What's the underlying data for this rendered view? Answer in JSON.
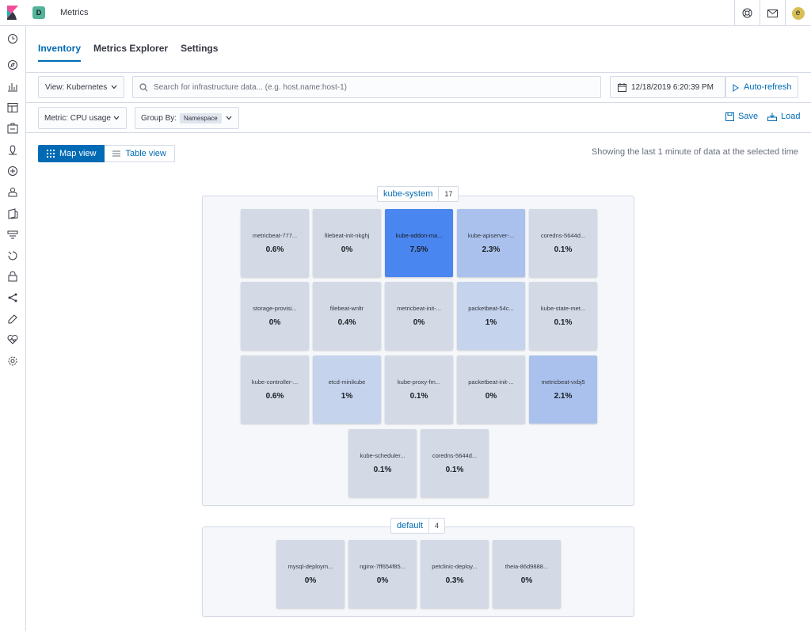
{
  "header": {
    "space_initial": "D",
    "app_title": "Metrics",
    "user_initial": "e"
  },
  "tabs": [
    {
      "label": "Inventory",
      "active": true
    },
    {
      "label": "Metrics Explorer",
      "active": false
    },
    {
      "label": "Settings",
      "active": false
    }
  ],
  "toolbar": {
    "view_select": "View: Kubernetes",
    "search_placeholder": "Search for infrastructure data... (e.g. host.name:host-1)",
    "date": "12/18/2019 6:20:39 PM",
    "auto_refresh": "Auto-refresh",
    "metric_select": "Metric: CPU usage",
    "group_by_label": "Group By:",
    "group_by_value": "Namespace",
    "save": "Save",
    "load": "Load"
  },
  "view_toggle": {
    "map": "Map view",
    "table": "Table view",
    "selected": "map"
  },
  "showing_text": "Showing the last 1 minute of data at the selected time",
  "colors": {
    "accent": "#006bb4",
    "node_low": "#d3dae6",
    "node_mid": "#c5d3ec",
    "node_high": "#a9c1ec",
    "node_max": "#4a86f0"
  },
  "groups": [
    {
      "name": "kube-system",
      "count": "17",
      "nodes": [
        {
          "name": "metricbeat-777...",
          "value": "0.6%",
          "level": "low"
        },
        {
          "name": "filebeat-init-nkghj",
          "value": "0%",
          "level": "low"
        },
        {
          "name": "kube-addon-ma...",
          "value": "7.5%",
          "level": "max"
        },
        {
          "name": "kube-apiserver-...",
          "value": "2.3%",
          "level": "high"
        },
        {
          "name": "coredns-5644d...",
          "value": "0.1%",
          "level": "low"
        },
        {
          "name": "storage-provisi...",
          "value": "0%",
          "level": "low"
        },
        {
          "name": "filebeat-wnltr",
          "value": "0.4%",
          "level": "low"
        },
        {
          "name": "metricbeat-init-...",
          "value": "0%",
          "level": "low"
        },
        {
          "name": "packetbeat-54c...",
          "value": "1%",
          "level": "mid"
        },
        {
          "name": "kube-state-met...",
          "value": "0.1%",
          "level": "low"
        },
        {
          "name": "kube-controller-...",
          "value": "0.6%",
          "level": "low"
        },
        {
          "name": "etcd-minikube",
          "value": "1%",
          "level": "mid"
        },
        {
          "name": "kube-proxy-fm...",
          "value": "0.1%",
          "level": "low"
        },
        {
          "name": "packetbeat-init-...",
          "value": "0%",
          "level": "low"
        },
        {
          "name": "metricbeat-vxbj5",
          "value": "2.1%",
          "level": "high"
        },
        {
          "name": "kube-scheduler...",
          "value": "0.1%",
          "level": "low"
        },
        {
          "name": "coredns-5644d...",
          "value": "0.1%",
          "level": "low"
        }
      ]
    },
    {
      "name": "default",
      "count": "4",
      "nodes": [
        {
          "name": "mysql-deploym...",
          "value": "0%",
          "level": "low"
        },
        {
          "name": "nginx-7ff654f85...",
          "value": "0%",
          "level": "low"
        },
        {
          "name": "petclinic-deploy...",
          "value": "0.3%",
          "level": "low"
        },
        {
          "name": "theia-86d9888...",
          "value": "0%",
          "level": "low"
        }
      ]
    }
  ]
}
